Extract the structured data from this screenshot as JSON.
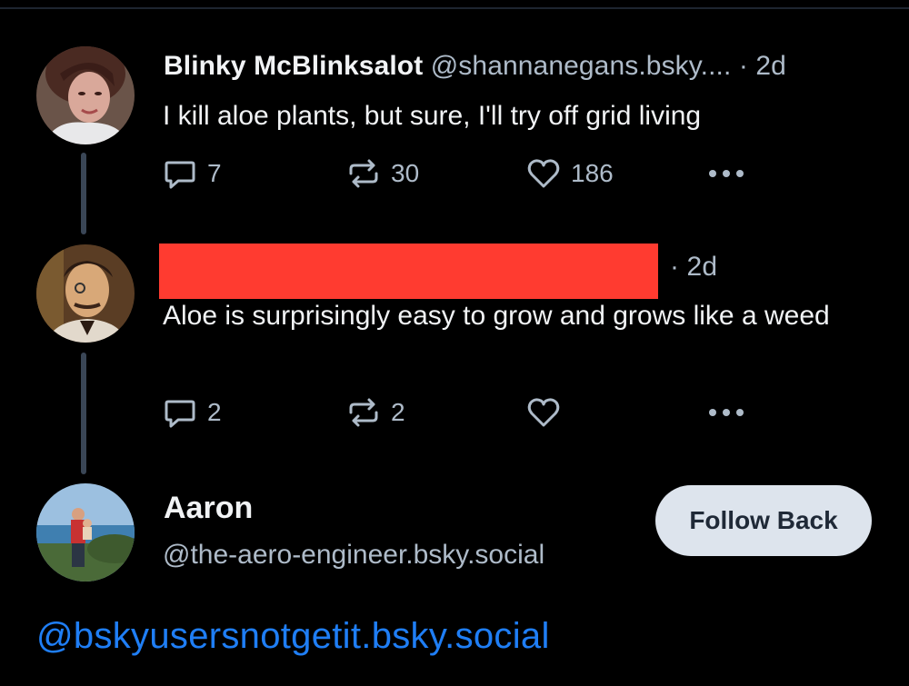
{
  "thread": {
    "post1": {
      "author_name": "Blinky McBlinksalot",
      "author_handle": "@shannanegans.bsky....",
      "separator": "·",
      "timestamp": "2d",
      "text": "I kill aloe plants, but sure, I'll try off grid living",
      "reply_count": "7",
      "repost_count": "30",
      "like_count": "186"
    },
    "post2": {
      "separator": "·",
      "timestamp": "2d",
      "text": "Aloe is surprisingly easy to grow and grows like a weed",
      "reply_count": "2",
      "repost_count": "2",
      "like_count": ""
    }
  },
  "follow_card": {
    "name": "Aaron",
    "handle": "@the-aero-engineer.bsky.social",
    "button_label": "Follow Back"
  },
  "footer": {
    "link_text": "@bskyusersnotgetit.bsky.social"
  },
  "colors": {
    "background": "#000000",
    "text_primary": "#f1f3f5",
    "text_secondary": "#aebbc9",
    "thread_line": "#3a4656",
    "redaction": "#ff3b30",
    "button_bg": "#dde4ed",
    "link": "#1f7ef5"
  },
  "icons": [
    "reply-icon",
    "repost-icon",
    "like-icon",
    "more-icon"
  ]
}
